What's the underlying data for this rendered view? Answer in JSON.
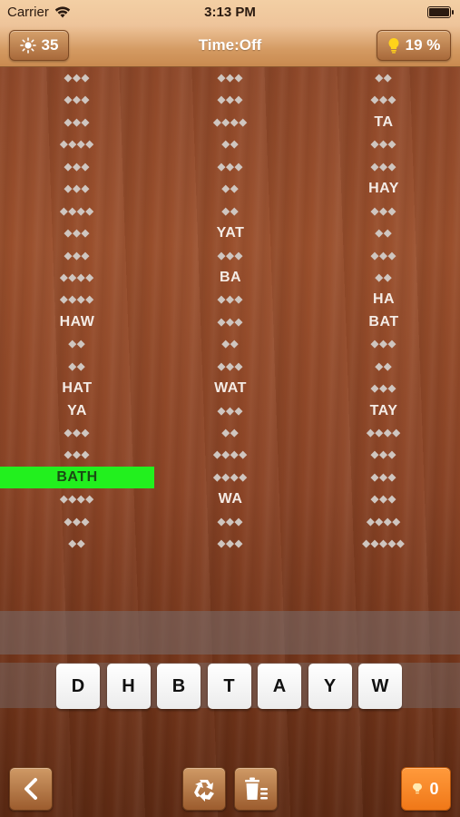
{
  "status": {
    "carrier": "Carrier",
    "time": "3:13 PM"
  },
  "header": {
    "coins": "35",
    "title": "Time:Off",
    "hint_percent": "19 %"
  },
  "columns": [
    [
      "◆◆◆",
      "◆◆◆",
      "◆◆◆",
      "◆◆◆◆",
      "◆◆◆",
      "◆◆◆",
      "◆◆◆◆",
      "◆◆◆",
      "◆◆◆",
      "◆◆◆◆",
      "◆◆◆◆",
      "HAW",
      "◆◆",
      "◆◆",
      "HAT",
      "YA",
      "◆◆◆",
      "◆◆◆",
      "BATH",
      "◆◆◆◆",
      "◆◆◆",
      "◆◆"
    ],
    [
      "◆◆◆",
      "◆◆◆",
      "◆◆◆◆",
      "◆◆",
      "◆◆◆",
      "◆◆",
      "◆◆",
      "YAT",
      "◆◆◆",
      "BA",
      "◆◆◆",
      "◆◆◆",
      "◆◆",
      "◆◆◆",
      "WAT",
      "◆◆◆",
      "◆◆",
      "◆◆◆◆",
      "◆◆◆◆",
      "WA",
      "◆◆◆",
      "◆◆◆"
    ],
    [
      "◆◆",
      "◆◆◆",
      "TA",
      "◆◆◆",
      "◆◆◆",
      "HAY",
      "◆◆◆",
      "◆◆",
      "◆◆◆",
      "◆◆",
      "HA",
      "BAT",
      "◆◆◆",
      "◆◆",
      "◆◆◆",
      "TAY",
      "◆◆◆◆",
      "◆◆◆",
      "◆◆◆",
      "◆◆◆",
      "◆◆◆◆",
      "◆◆◆◆◆"
    ]
  ],
  "active_word": "BATH",
  "letters": [
    "D",
    "H",
    "B",
    "T",
    "A",
    "Y",
    "W"
  ],
  "footer": {
    "hint_count": "0"
  },
  "colors": {
    "highlight": "#22f01e",
    "hint_button": "#f07818"
  }
}
